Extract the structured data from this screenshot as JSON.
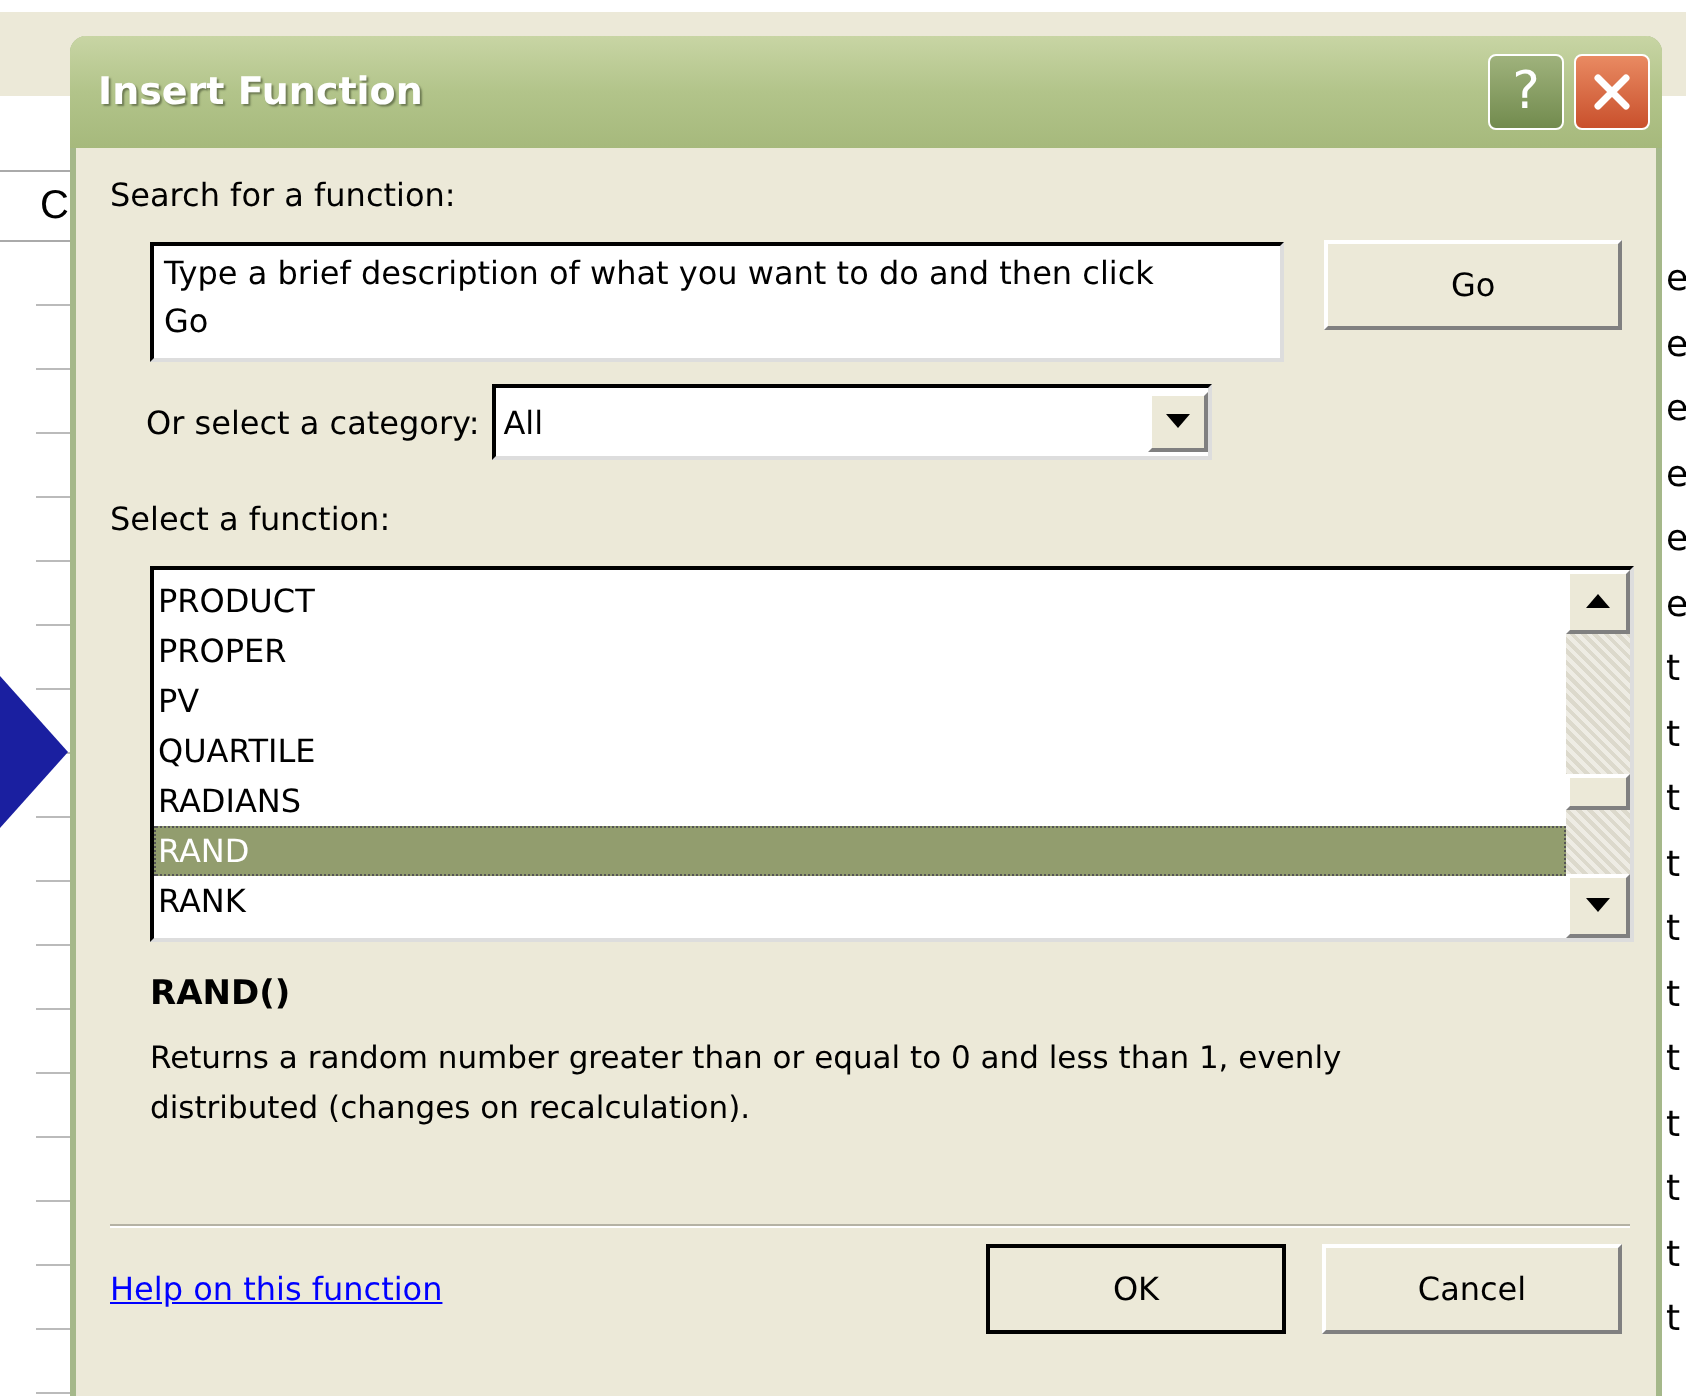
{
  "spreadsheet": {
    "column_header": "C",
    "right_cells": [
      "e",
      "e",
      "e",
      "e",
      "e",
      "e",
      "t",
      "t",
      "t",
      "t",
      "t",
      "t",
      "t",
      "t",
      "t",
      "t",
      "t"
    ]
  },
  "dialog": {
    "title": "Insert Function",
    "help_button": "?",
    "search": {
      "label": "Search for a function:",
      "value": "Type a brief description of what you want to do and then click Go",
      "button": "Go"
    },
    "category": {
      "label": "Or select a category:",
      "value": "All"
    },
    "function_list": {
      "label": "Select a function:",
      "items": [
        {
          "name": "PRODUCT",
          "selected": false
        },
        {
          "name": "PROPER",
          "selected": false
        },
        {
          "name": "PV",
          "selected": false
        },
        {
          "name": "QUARTILE",
          "selected": false
        },
        {
          "name": "RADIANS",
          "selected": false
        },
        {
          "name": "RAND",
          "selected": true
        },
        {
          "name": "RANK",
          "selected": false
        }
      ]
    },
    "signature": "RAND()",
    "description": "Returns a random number greater than or equal to 0 and less than 1, evenly distributed (changes on recalculation).",
    "help_link": "Help on this function",
    "buttons": [
      "OK",
      "Cancel"
    ]
  }
}
